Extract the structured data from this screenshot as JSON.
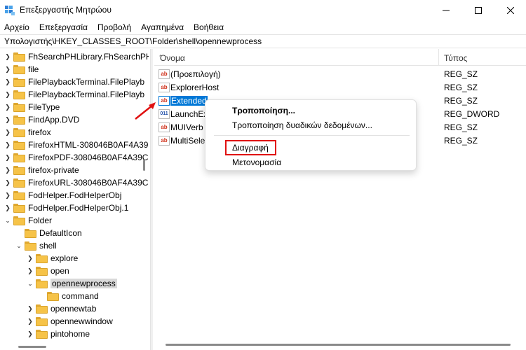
{
  "window": {
    "title": "Επεξεργαστής Μητρώου"
  },
  "menu": {
    "items": [
      "Αρχείο",
      "Επεξεργασία",
      "Προβολή",
      "Αγαπημένα",
      "Βοήθεια"
    ]
  },
  "address": {
    "path": "Υπολογιστής\\HKEY_CLASSES_ROOT\\Folder\\shell\\opennewprocess"
  },
  "tree": {
    "items": [
      {
        "label": "FhSearchPHLibrary.FhSearchPH",
        "expanded": false
      },
      {
        "label": "file",
        "expanded": false
      },
      {
        "label": "FilePlaybackTerminal.FilePlayb",
        "expanded": false
      },
      {
        "label": "FilePlaybackTerminal.FilePlayb",
        "expanded": false
      },
      {
        "label": "FileType",
        "expanded": false
      },
      {
        "label": "FindApp.DVD",
        "expanded": false
      },
      {
        "label": "firefox",
        "expanded": false
      },
      {
        "label": "FirefoxHTML-308046B0AF4A39C",
        "expanded": false
      },
      {
        "label": "FirefoxPDF-308046B0AF4A39C",
        "expanded": false
      },
      {
        "label": "firefox-private",
        "expanded": false
      },
      {
        "label": "FirefoxURL-308046B0AF4A39C",
        "expanded": false
      },
      {
        "label": "FodHelper.FodHelperObj",
        "expanded": false
      },
      {
        "label": "FodHelper.FodHelperObj.1",
        "expanded": false
      },
      {
        "label": "Folder",
        "expanded": true
      },
      {
        "label": "DefaultIcon",
        "expanded": null
      },
      {
        "label": "shell",
        "expanded": true
      },
      {
        "label": "explore",
        "expanded": false
      },
      {
        "label": "open",
        "expanded": false
      },
      {
        "label": "opennewprocess",
        "expanded": true,
        "selected": true
      },
      {
        "label": "command",
        "expanded": null
      },
      {
        "label": "opennewtab",
        "expanded": false
      },
      {
        "label": "opennewwindow",
        "expanded": false
      },
      {
        "label": "pintohome",
        "expanded": false
      }
    ]
  },
  "list": {
    "columns": {
      "name": "Όνομα",
      "type": "Τύπος"
    },
    "rows": [
      {
        "name": "(Προεπιλογή)",
        "type": "REG_SZ",
        "icon": "string-value-icon"
      },
      {
        "name": "ExplorerHost",
        "type": "REG_SZ",
        "icon": "string-value-icon"
      },
      {
        "name": "Extended",
        "type": "REG_SZ",
        "icon": "string-value-icon",
        "selected": true
      },
      {
        "name": "LaunchEx",
        "type": "REG_DWORD",
        "icon": "dword-value-icon"
      },
      {
        "name": "MUIVerb",
        "type": "REG_SZ",
        "icon": "string-value-icon"
      },
      {
        "name": "MultiSele",
        "type": "REG_SZ",
        "icon": "string-value-icon"
      }
    ]
  },
  "context_menu": {
    "modify": "Τροποποίηση...",
    "modify_binary": "Τροποποίηση δυαδικών δεδομένων...",
    "delete": "Διαγραφή",
    "rename": "Μετονομασία"
  },
  "colors": {
    "selection": "#0078d7",
    "highlight_box": "#e01010",
    "folder": "#f6c348"
  }
}
